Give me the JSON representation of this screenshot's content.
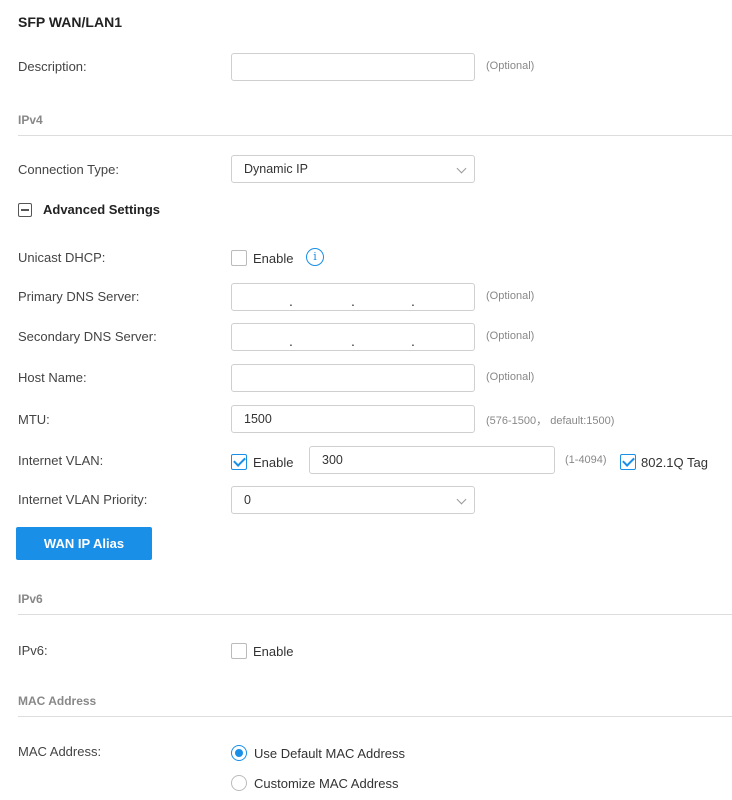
{
  "page_title": "SFP WAN/LAN1",
  "description": {
    "label": "Description:",
    "value": "",
    "hint": "(Optional)"
  },
  "ipv4": {
    "heading": "IPv4",
    "connection_type": {
      "label": "Connection Type:",
      "value": "Dynamic IP"
    },
    "advanced_settings": "Advanced Settings",
    "unicast_dhcp": {
      "label": "Unicast DHCP:",
      "enable_label": "Enable",
      "checked": false,
      "info_icon": "i"
    },
    "primary_dns": {
      "label": "Primary DNS Server:",
      "hint": "(Optional)",
      "dot": "."
    },
    "secondary_dns": {
      "label": "Secondary DNS Server:",
      "hint": "(Optional)",
      "dot": "."
    },
    "host_name": {
      "label": "Host Name:",
      "value": "",
      "hint": "(Optional)"
    },
    "mtu": {
      "label": "MTU:",
      "value": "1500",
      "hint": "(576-1500， default:1500)"
    },
    "internet_vlan": {
      "label": "Internet VLAN:",
      "enable_label": "Enable",
      "checked": true,
      "value": "300",
      "range_hint": "(1-4094)",
      "tag_label": "802.1Q Tag",
      "tag_checked": true
    },
    "vlan_priority": {
      "label": "Internet VLAN Priority:",
      "value": "0"
    },
    "wan_ip_alias_button": "WAN IP Alias"
  },
  "ipv6": {
    "heading": "IPv6",
    "ipv6_field": {
      "label": "IPv6:",
      "enable_label": "Enable",
      "checked": false
    }
  },
  "mac": {
    "heading": "MAC Address",
    "label": "MAC Address:",
    "options": [
      {
        "label": "Use Default MAC Address",
        "selected": true
      },
      {
        "label": "Customize MAC Address",
        "selected": false
      }
    ]
  },
  "colors": {
    "accent": "#1a8fe8",
    "border": "#cfcfcf",
    "section_heading": "#888888"
  },
  "icons": {
    "info": "info-icon",
    "collapse": "minus-square-icon",
    "dropdown": "chevron-down-icon"
  }
}
